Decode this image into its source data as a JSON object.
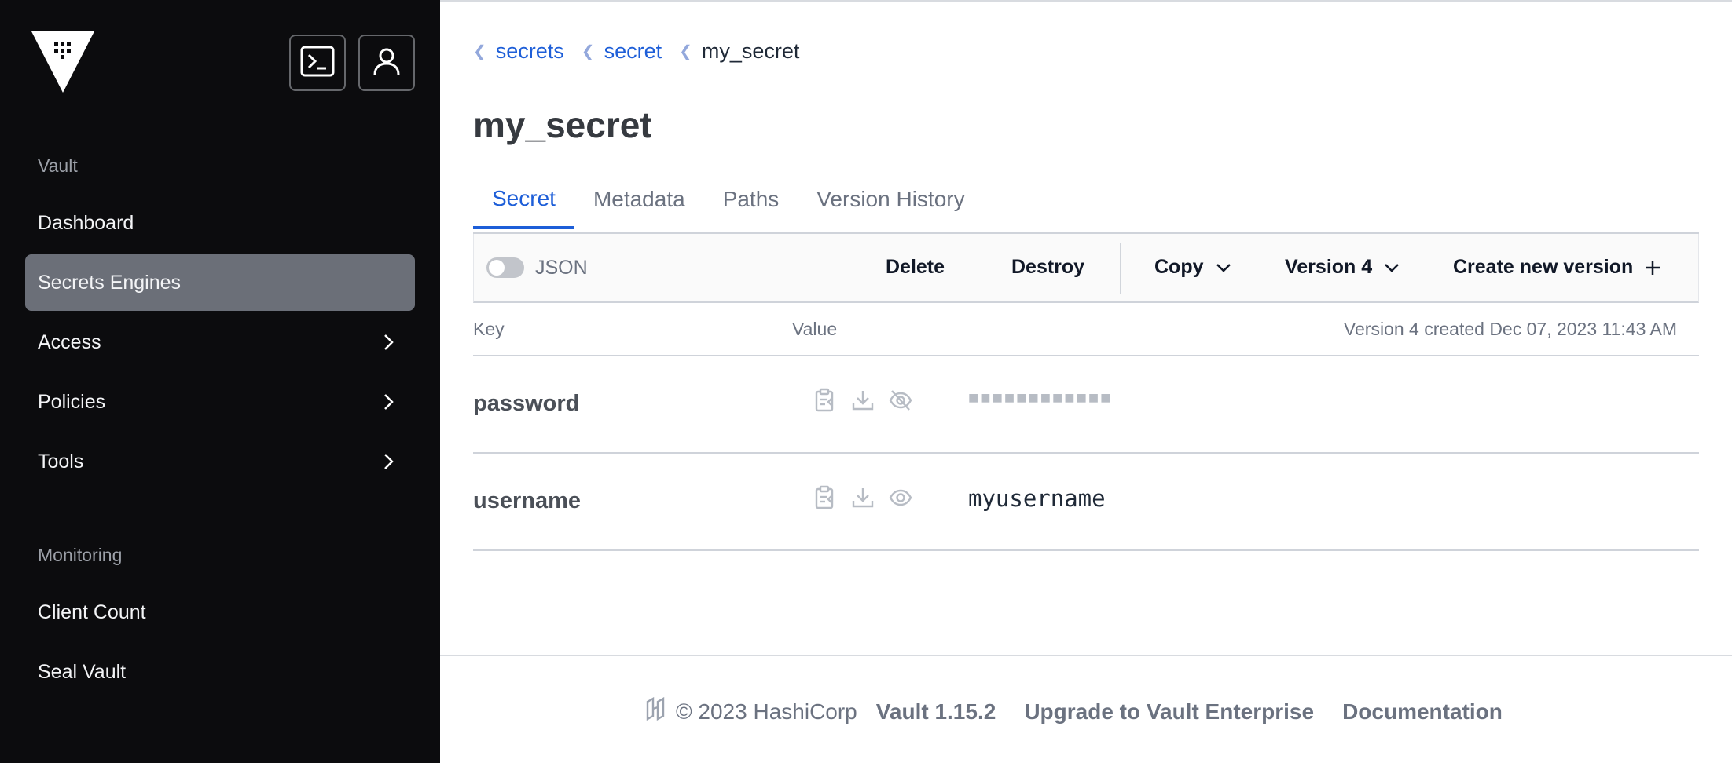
{
  "sidebar": {
    "sections": [
      {
        "title": "Vault",
        "items": [
          {
            "label": "Dashboard"
          },
          {
            "label": "Secrets Engines"
          },
          {
            "label": "Access"
          },
          {
            "label": "Policies"
          },
          {
            "label": "Tools"
          }
        ]
      },
      {
        "title": "Monitoring",
        "items": [
          {
            "label": "Client Count"
          },
          {
            "label": "Seal Vault"
          }
        ]
      }
    ],
    "active_item": "Secrets Engines"
  },
  "breadcrumb": [
    "secrets",
    "secret",
    "my_secret"
  ],
  "page_title": "my_secret",
  "tabs": [
    "Secret",
    "Metadata",
    "Paths",
    "Version History"
  ],
  "active_tab": "Secret",
  "toolbar": {
    "json_toggle_label": "JSON",
    "json_toggle_on": false,
    "delete_label": "Delete",
    "destroy_label": "Destroy",
    "copy_label": "Copy",
    "version_label": "Version 4",
    "create_label": "Create new version"
  },
  "table": {
    "key_header": "Key",
    "value_header": "Value",
    "version_info": "Version 4 created Dec 07, 2023 11:43 AM",
    "rows": [
      {
        "key": "password",
        "masked": "■■■■■■■■■■■■",
        "visible": false
      },
      {
        "key": "username",
        "value": "myusername",
        "visible": true
      }
    ]
  },
  "footer": {
    "copyright": "© 2023 HashiCorp",
    "version": "Vault 1.15.2",
    "upgrade_link": "Upgrade to Vault Enterprise",
    "docs_link": "Documentation"
  },
  "colors": {
    "sidebar_bg": "#0c0c0e",
    "active_nav_bg": "#6b6f78",
    "accent": "#1d5ed8"
  }
}
